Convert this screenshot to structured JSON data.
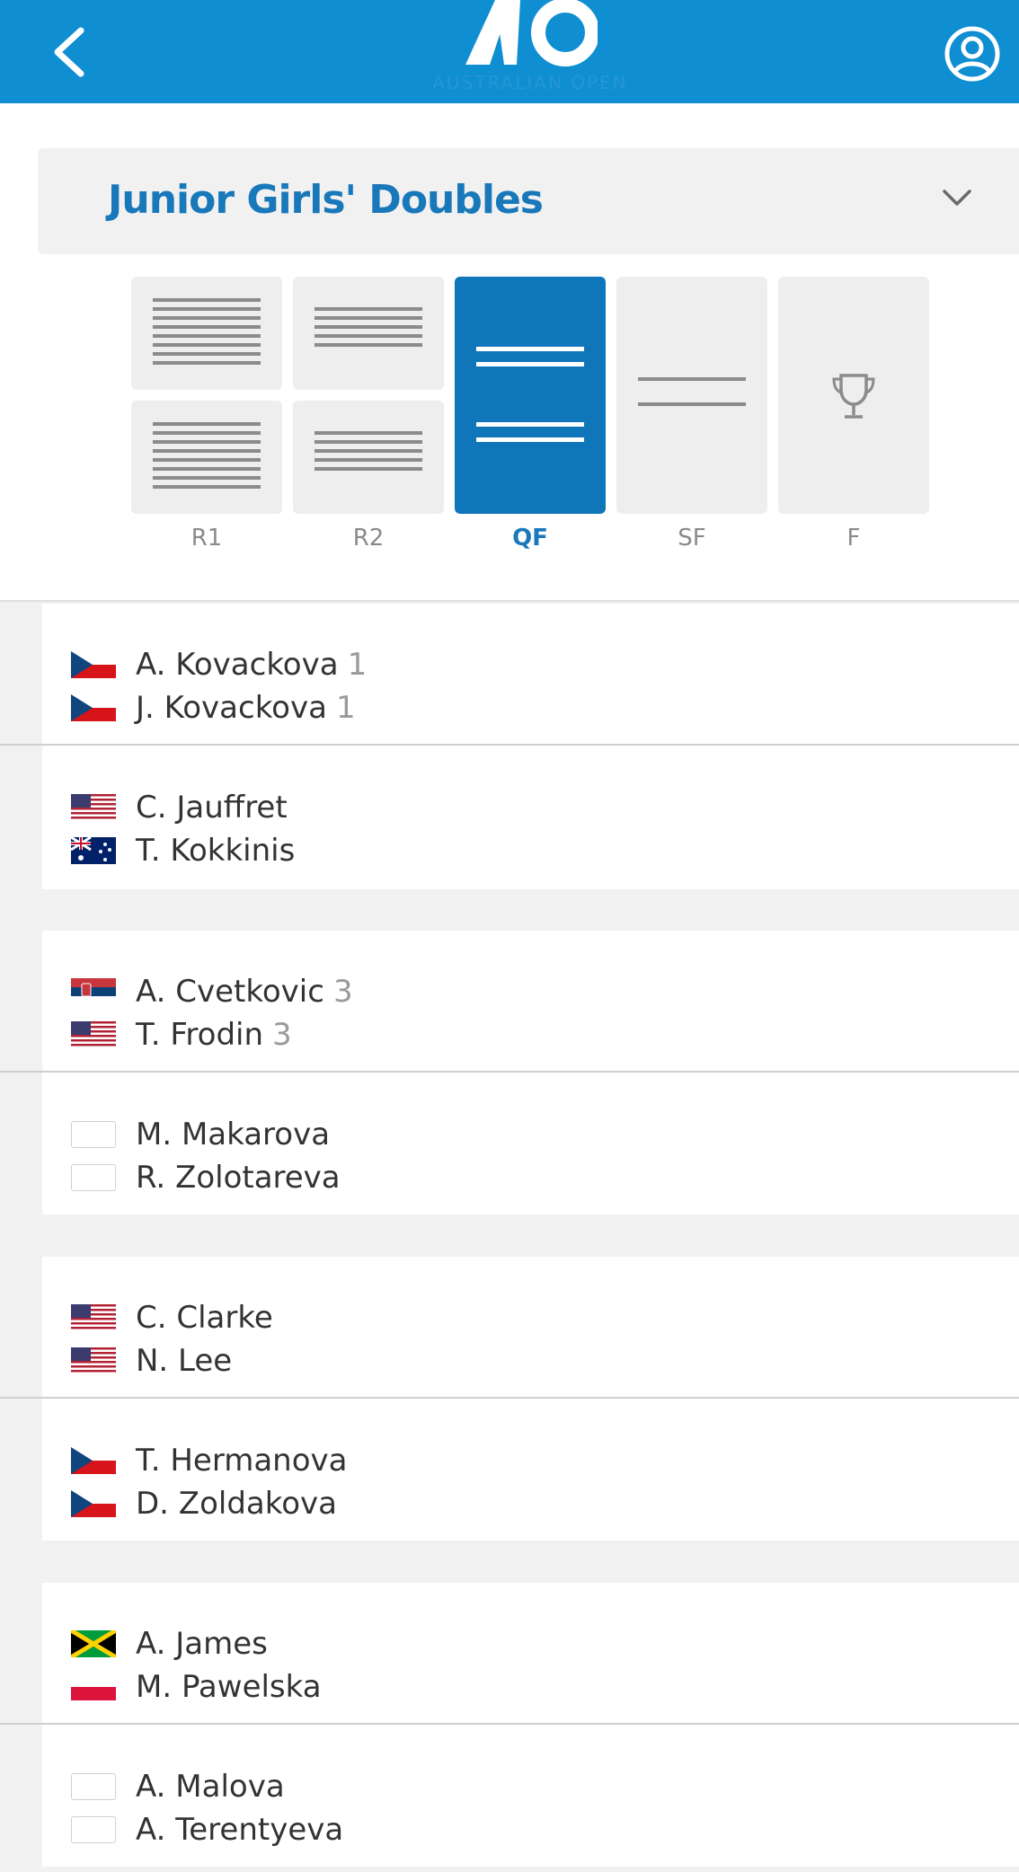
{
  "header": {
    "logo_text": "AO",
    "logo_subtext": "AUSTRALIAN OPEN"
  },
  "event": {
    "title": "Junior Girls' Doubles"
  },
  "rounds": [
    {
      "label": "R1"
    },
    {
      "label": "R2"
    },
    {
      "label": "QF",
      "selected": true
    },
    {
      "label": "SF"
    },
    {
      "label": "F"
    }
  ],
  "matches": [
    {
      "team1": {
        "players": [
          {
            "name": "A. Kovackova",
            "seed": "1",
            "flag": "cze"
          },
          {
            "name": "J. Kovackova",
            "seed": "1",
            "flag": "cze"
          }
        ]
      },
      "team2": {
        "players": [
          {
            "name": "C. Jauffret",
            "seed": "",
            "flag": "usa"
          },
          {
            "name": "T. Kokkinis",
            "seed": "",
            "flag": "aus"
          }
        ]
      }
    },
    {
      "team1": {
        "players": [
          {
            "name": "A. Cvetkovic",
            "seed": "3",
            "flag": "srb"
          },
          {
            "name": "T. Frodin",
            "seed": "3",
            "flag": "usa"
          }
        ]
      },
      "team2": {
        "players": [
          {
            "name": "M. Makarova",
            "seed": "",
            "flag": "none"
          },
          {
            "name": "R. Zolotareva",
            "seed": "",
            "flag": "none"
          }
        ]
      }
    },
    {
      "team1": {
        "players": [
          {
            "name": "C. Clarke",
            "seed": "",
            "flag": "usa"
          },
          {
            "name": "N. Lee",
            "seed": "",
            "flag": "usa"
          }
        ]
      },
      "team2": {
        "players": [
          {
            "name": "T. Hermanova",
            "seed": "",
            "flag": "cze"
          },
          {
            "name": "D. Zoldakova",
            "seed": "",
            "flag": "cze"
          }
        ]
      }
    },
    {
      "team1": {
        "players": [
          {
            "name": "A. James",
            "seed": "",
            "flag": "jam"
          },
          {
            "name": "M. Pawelska",
            "seed": "",
            "flag": "pol"
          }
        ]
      },
      "team2": {
        "players": [
          {
            "name": "A. Malova",
            "seed": "",
            "flag": "none"
          },
          {
            "name": "A. Terentyeva",
            "seed": "",
            "flag": "none"
          }
        ]
      }
    }
  ],
  "colors": {
    "header_blue": "#0f8ed1",
    "accent_blue": "#1978b9",
    "selected_tab": "#0f76b9"
  }
}
